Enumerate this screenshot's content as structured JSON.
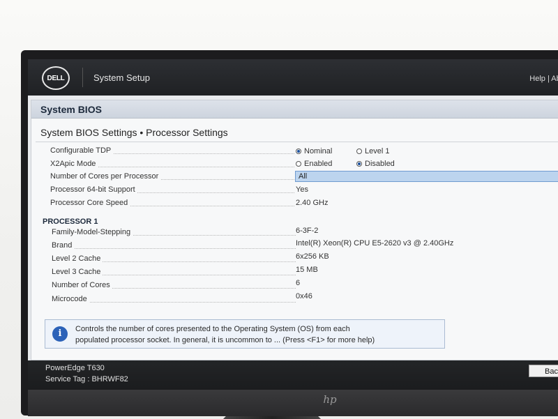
{
  "header": {
    "logo_text": "DELL",
    "app_title": "System Setup",
    "help_label": "Help",
    "separator": "|",
    "about_label": "Abou"
  },
  "bios_title": "System BIOS",
  "page_title": "System BIOS Settings • Processor Settings",
  "settings": {
    "configurable_tdp": {
      "label": "Configurable TDP",
      "options": [
        {
          "label": "Nominal",
          "selected": true
        },
        {
          "label": "Level 1",
          "selected": false
        }
      ]
    },
    "x2apic_mode": {
      "label": "X2Apic Mode",
      "options": [
        {
          "label": "Enabled",
          "selected": false
        },
        {
          "label": "Disabled",
          "selected": true
        }
      ]
    },
    "cores_per_processor": {
      "label": "Number of Cores per Processor",
      "value": "All"
    },
    "support_64bit": {
      "label": "Processor 64-bit Support",
      "value": "Yes"
    },
    "core_speed": {
      "label": "Processor Core Speed",
      "value": "2.40 GHz"
    }
  },
  "processor1": {
    "heading": "PROCESSOR 1",
    "rows": [
      {
        "label": "Family-Model-Stepping",
        "value": "6-3F-2"
      },
      {
        "label": "Brand",
        "value": "Intel(R) Xeon(R) CPU E5-2620 v3 @ 2.40GHz"
      },
      {
        "label": "Level 2 Cache",
        "value": "6x256 KB"
      },
      {
        "label": "Level 3 Cache",
        "value": "15 MB"
      },
      {
        "label": "Number of Cores",
        "value": "6"
      },
      {
        "label": "Microcode",
        "value": "0x46"
      }
    ]
  },
  "help": {
    "icon": "info-icon",
    "line1": "Controls the number of cores presented to the Operating System (OS) from each",
    "line2": "populated processor socket. In general, it is uncommon to ... (Press <F1> for more help)"
  },
  "footer": {
    "model": "PowerEdge T630",
    "service_tag": "Service Tag : BHRWF82",
    "back_label": "Bac"
  },
  "colors": {
    "accent": "#2c62b8",
    "selection": "#bcd4ee",
    "topbar": "#1f2124"
  }
}
